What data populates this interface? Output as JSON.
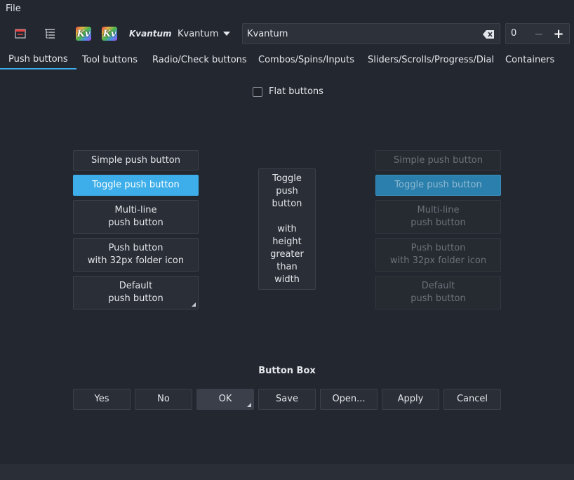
{
  "menubar": {
    "file": "File"
  },
  "toolbar": {
    "theme_label": "Kvantum",
    "theme_combo_value": "Kvantum",
    "search_value": "Kvantum",
    "spin_value": "0",
    "kv_icon_text": "Kv"
  },
  "tabs": [
    {
      "label": "Push buttons"
    },
    {
      "label": "Tool buttons"
    },
    {
      "label": "Radio/Check buttons"
    },
    {
      "label": "Combos/Spins/Inputs"
    },
    {
      "label": "Sliders/Scrolls/Progress/Dial"
    },
    {
      "label": "Containers"
    }
  ],
  "flat_buttons": {
    "label": "Flat buttons",
    "checked": false
  },
  "push_buttons": {
    "simple": "Simple push button",
    "toggle": "Toggle push button",
    "multiline": "Multi-line\npush button",
    "folder": "Push button\nwith 32px folder icon",
    "default": "Default\npush button",
    "tall": "Toggle\npush\nbutton\n\nwith\nheight\ngreater\nthan\nwidth"
  },
  "button_box": {
    "title": "Button Box",
    "yes": "Yes",
    "no": "No",
    "ok": "OK",
    "save": "Save",
    "open": "Open...",
    "apply": "Apply",
    "cancel": "Cancel"
  },
  "colors": {
    "accent": "#3daee9",
    "background": "#232730",
    "button": "#2a2e36"
  }
}
